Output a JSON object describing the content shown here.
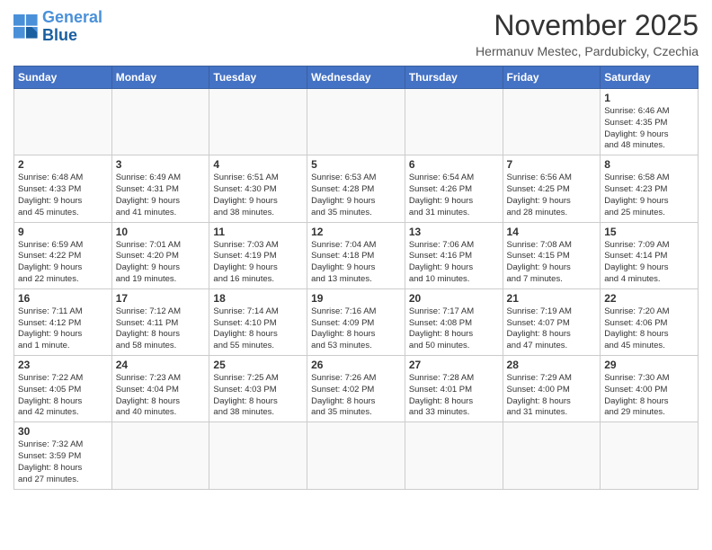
{
  "header": {
    "logo_general": "General",
    "logo_blue": "Blue",
    "title": "November 2025",
    "location": "Hermanuv Mestec, Pardubicky, Czechia"
  },
  "days_of_week": [
    "Sunday",
    "Monday",
    "Tuesday",
    "Wednesday",
    "Thursday",
    "Friday",
    "Saturday"
  ],
  "weeks": [
    [
      {
        "day": "",
        "info": ""
      },
      {
        "day": "",
        "info": ""
      },
      {
        "day": "",
        "info": ""
      },
      {
        "day": "",
        "info": ""
      },
      {
        "day": "",
        "info": ""
      },
      {
        "day": "",
        "info": ""
      },
      {
        "day": "1",
        "info": "Sunrise: 6:46 AM\nSunset: 4:35 PM\nDaylight: 9 hours\nand 48 minutes."
      }
    ],
    [
      {
        "day": "2",
        "info": "Sunrise: 6:48 AM\nSunset: 4:33 PM\nDaylight: 9 hours\nand 45 minutes."
      },
      {
        "day": "3",
        "info": "Sunrise: 6:49 AM\nSunset: 4:31 PM\nDaylight: 9 hours\nand 41 minutes."
      },
      {
        "day": "4",
        "info": "Sunrise: 6:51 AM\nSunset: 4:30 PM\nDaylight: 9 hours\nand 38 minutes."
      },
      {
        "day": "5",
        "info": "Sunrise: 6:53 AM\nSunset: 4:28 PM\nDaylight: 9 hours\nand 35 minutes."
      },
      {
        "day": "6",
        "info": "Sunrise: 6:54 AM\nSunset: 4:26 PM\nDaylight: 9 hours\nand 31 minutes."
      },
      {
        "day": "7",
        "info": "Sunrise: 6:56 AM\nSunset: 4:25 PM\nDaylight: 9 hours\nand 28 minutes."
      },
      {
        "day": "8",
        "info": "Sunrise: 6:58 AM\nSunset: 4:23 PM\nDaylight: 9 hours\nand 25 minutes."
      }
    ],
    [
      {
        "day": "9",
        "info": "Sunrise: 6:59 AM\nSunset: 4:22 PM\nDaylight: 9 hours\nand 22 minutes."
      },
      {
        "day": "10",
        "info": "Sunrise: 7:01 AM\nSunset: 4:20 PM\nDaylight: 9 hours\nand 19 minutes."
      },
      {
        "day": "11",
        "info": "Sunrise: 7:03 AM\nSunset: 4:19 PM\nDaylight: 9 hours\nand 16 minutes."
      },
      {
        "day": "12",
        "info": "Sunrise: 7:04 AM\nSunset: 4:18 PM\nDaylight: 9 hours\nand 13 minutes."
      },
      {
        "day": "13",
        "info": "Sunrise: 7:06 AM\nSunset: 4:16 PM\nDaylight: 9 hours\nand 10 minutes."
      },
      {
        "day": "14",
        "info": "Sunrise: 7:08 AM\nSunset: 4:15 PM\nDaylight: 9 hours\nand 7 minutes."
      },
      {
        "day": "15",
        "info": "Sunrise: 7:09 AM\nSunset: 4:14 PM\nDaylight: 9 hours\nand 4 minutes."
      }
    ],
    [
      {
        "day": "16",
        "info": "Sunrise: 7:11 AM\nSunset: 4:12 PM\nDaylight: 9 hours\nand 1 minute."
      },
      {
        "day": "17",
        "info": "Sunrise: 7:12 AM\nSunset: 4:11 PM\nDaylight: 8 hours\nand 58 minutes."
      },
      {
        "day": "18",
        "info": "Sunrise: 7:14 AM\nSunset: 4:10 PM\nDaylight: 8 hours\nand 55 minutes."
      },
      {
        "day": "19",
        "info": "Sunrise: 7:16 AM\nSunset: 4:09 PM\nDaylight: 8 hours\nand 53 minutes."
      },
      {
        "day": "20",
        "info": "Sunrise: 7:17 AM\nSunset: 4:08 PM\nDaylight: 8 hours\nand 50 minutes."
      },
      {
        "day": "21",
        "info": "Sunrise: 7:19 AM\nSunset: 4:07 PM\nDaylight: 8 hours\nand 47 minutes."
      },
      {
        "day": "22",
        "info": "Sunrise: 7:20 AM\nSunset: 4:06 PM\nDaylight: 8 hours\nand 45 minutes."
      }
    ],
    [
      {
        "day": "23",
        "info": "Sunrise: 7:22 AM\nSunset: 4:05 PM\nDaylight: 8 hours\nand 42 minutes."
      },
      {
        "day": "24",
        "info": "Sunrise: 7:23 AM\nSunset: 4:04 PM\nDaylight: 8 hours\nand 40 minutes."
      },
      {
        "day": "25",
        "info": "Sunrise: 7:25 AM\nSunset: 4:03 PM\nDaylight: 8 hours\nand 38 minutes."
      },
      {
        "day": "26",
        "info": "Sunrise: 7:26 AM\nSunset: 4:02 PM\nDaylight: 8 hours\nand 35 minutes."
      },
      {
        "day": "27",
        "info": "Sunrise: 7:28 AM\nSunset: 4:01 PM\nDaylight: 8 hours\nand 33 minutes."
      },
      {
        "day": "28",
        "info": "Sunrise: 7:29 AM\nSunset: 4:00 PM\nDaylight: 8 hours\nand 31 minutes."
      },
      {
        "day": "29",
        "info": "Sunrise: 7:30 AM\nSunset: 4:00 PM\nDaylight: 8 hours\nand 29 minutes."
      }
    ],
    [
      {
        "day": "30",
        "info": "Sunrise: 7:32 AM\nSunset: 3:59 PM\nDaylight: 8 hours\nand 27 minutes."
      },
      {
        "day": "",
        "info": ""
      },
      {
        "day": "",
        "info": ""
      },
      {
        "day": "",
        "info": ""
      },
      {
        "day": "",
        "info": ""
      },
      {
        "day": "",
        "info": ""
      },
      {
        "day": "",
        "info": ""
      }
    ]
  ]
}
